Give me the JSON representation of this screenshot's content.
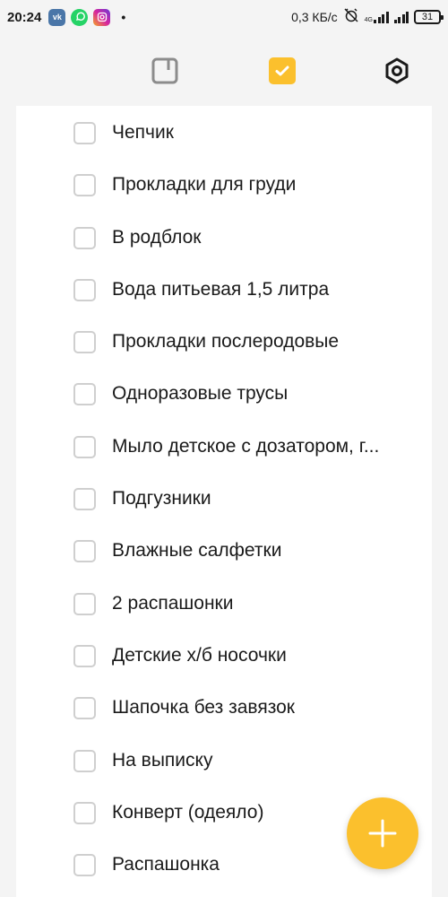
{
  "status_bar": {
    "time": "20:24",
    "apps": [
      "vk-icon",
      "whatsapp-icon",
      "instagram-icon"
    ],
    "dot": "•",
    "speed": "0,3 КБ/с",
    "network": "4G",
    "battery": "31"
  },
  "toolbar": {
    "notes_icon": "note-icon",
    "tasks_icon": "checkbox-checked-icon",
    "settings_icon": "gear-icon",
    "accent_color": "#fbc02d",
    "inactive_color": "#8c8c8c"
  },
  "tasks": [
    "Чепчик",
    "Прокладки для груди",
    "В родблок",
    "Вода питьевая 1,5 литра",
    "Прокладки послеродовые",
    "Одноразовые трусы",
    "Мыло детское с дозатором, г...",
    "Подгузники",
    "Влажные салфетки",
    "2 распашонки",
    "Детские х/б носочки",
    "Шапочка без завязок",
    "На выписку",
    "Конверт (одеяло)",
    "Распашонка"
  ],
  "fab": {
    "icon": "plus-icon",
    "color": "#fbc02d"
  }
}
